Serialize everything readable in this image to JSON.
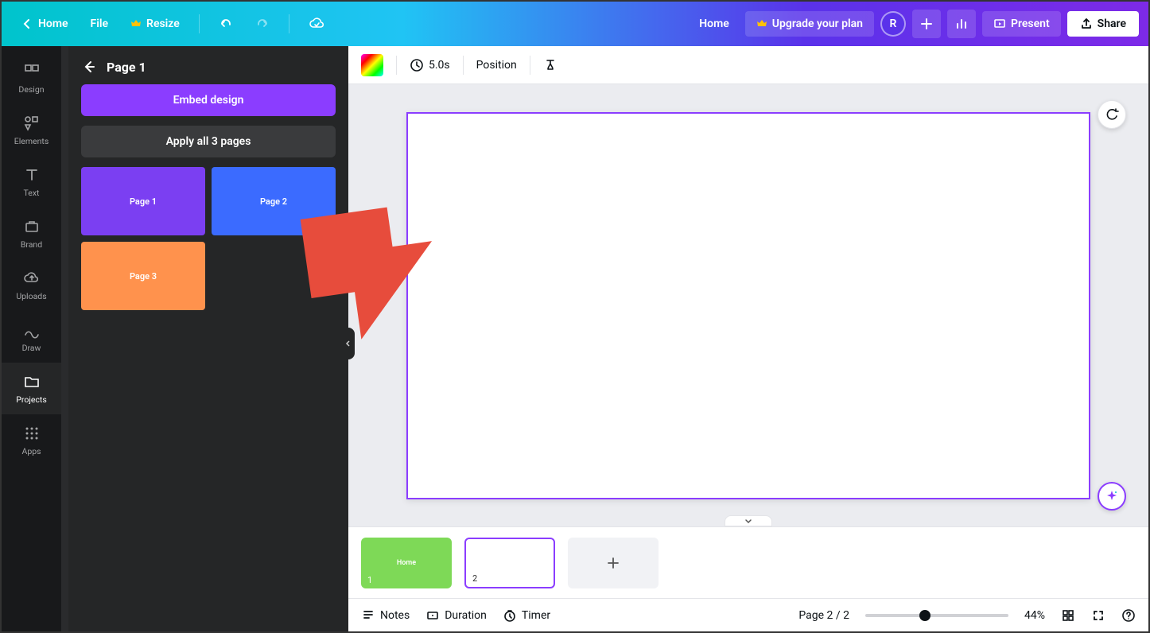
{
  "topbar": {
    "home": "Home",
    "file": "File",
    "resize": "Resize",
    "home2": "Home",
    "upgrade": "Upgrade your plan",
    "avatar_initial": "R",
    "present": "Present",
    "share": "Share"
  },
  "rail": {
    "design": "Design",
    "elements": "Elements",
    "text": "Text",
    "brand": "Brand",
    "uploads": "Uploads",
    "draw": "Draw",
    "projects": "Projects",
    "apps": "Apps"
  },
  "panel": {
    "title": "Page 1",
    "embed": "Embed design",
    "apply_all": "Apply all 3 pages",
    "thumbs": [
      "Page 1",
      "Page 2",
      "Page 3"
    ]
  },
  "context": {
    "duration": "5.0s",
    "position": "Position"
  },
  "strip": {
    "page1_label": "Home",
    "page1_num": "1",
    "page2_num": "2"
  },
  "bottom": {
    "notes": "Notes",
    "duration": "Duration",
    "timer": "Timer",
    "page_indicator": "Page 2 / 2",
    "zoom": "44%"
  }
}
